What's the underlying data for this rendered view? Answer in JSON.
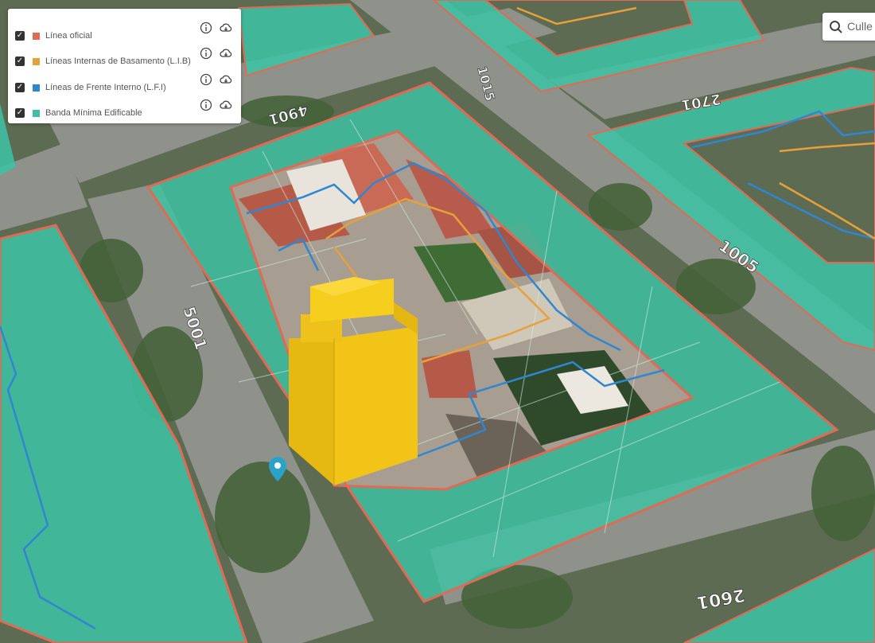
{
  "layers": [
    {
      "label": "Línea oficial",
      "color": "#e06a55",
      "checked": true
    },
    {
      "label": "Líneas Internas de Basamento (L.I.B)",
      "color": "#e8a13a",
      "checked": true
    },
    {
      "label": "Líneas de Frente Interno (L.F.I)",
      "color": "#2f86d1",
      "checked": true
    },
    {
      "label": "Banda Mínima Edificable",
      "color": "#3dbfa3",
      "checked": true
    }
  ],
  "search": {
    "text": "Culle"
  },
  "road_labels": [
    "1015",
    "2701",
    "4901",
    "5001",
    "1005",
    "2601"
  ],
  "colors": {
    "banda": "#3cc3a4",
    "linea_oficial": "#e06a55",
    "lib": "#e8a13a",
    "lfi": "#2f86d1",
    "building": "#f2c417",
    "road": "#8c8c88",
    "vegetation": "#4d6a3a"
  }
}
